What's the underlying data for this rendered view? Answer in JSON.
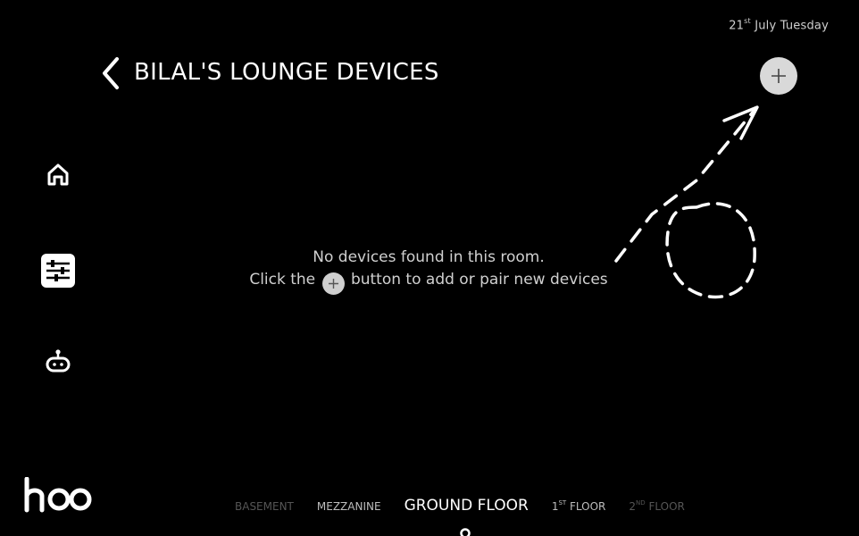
{
  "date": {
    "day": "21",
    "suffix": "st",
    "rest": " July Tuesday"
  },
  "header": {
    "title": "BILAL'S LOUNGE DEVICES"
  },
  "icons": {
    "back": "chevron-left-icon",
    "add": "plus-icon",
    "home": "home-icon",
    "controls": "sliders-icon",
    "automation": "robot-icon"
  },
  "empty_state": {
    "line1": "No devices found in this room.",
    "line2_before": "Click the",
    "line2_after": "button to add or pair new devices"
  },
  "brand": {
    "logo_text": "hoo"
  },
  "floors": [
    {
      "label": "BASEMENT"
    },
    {
      "label": "MEZZANINE"
    },
    {
      "label": "GROUND FLOOR",
      "active": true
    },
    {
      "num": "1",
      "sup": "ST",
      "label": " FLOOR"
    },
    {
      "num": "2",
      "sup": "ND",
      "label": " FLOOR"
    }
  ],
  "colors": {
    "background": "#000000",
    "accent": "#d9d9d9"
  }
}
